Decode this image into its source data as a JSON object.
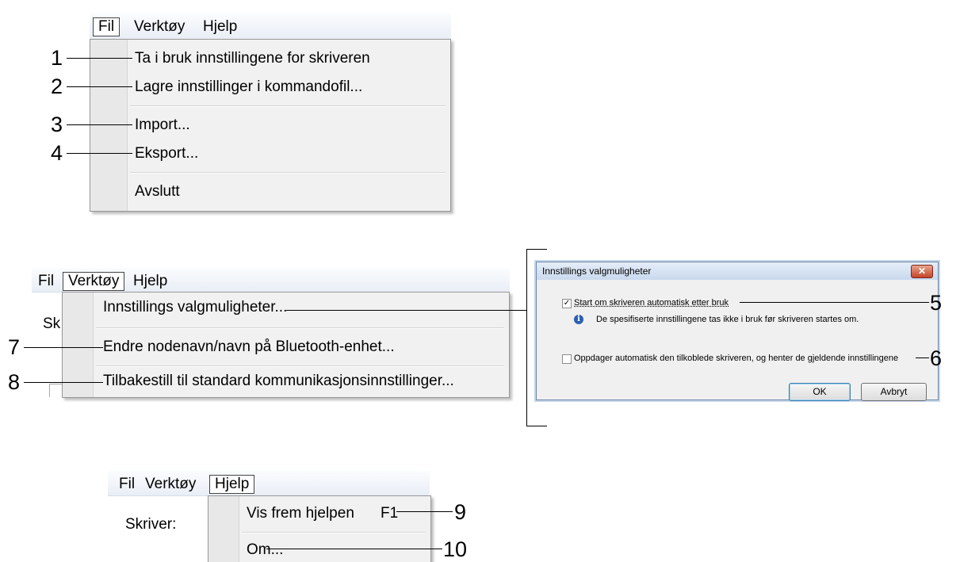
{
  "panel1": {
    "menubar": {
      "fil": "Fil",
      "verktoy": "Verktøy",
      "hjelp": "Hjelp"
    },
    "items": [
      "Ta i bruk innstillingene for skriveren",
      "Lagre innstillinger i kommandofil...",
      "Import...",
      "Eksport...",
      "Avslutt"
    ],
    "callouts": [
      "1",
      "2",
      "3",
      "4"
    ]
  },
  "panel2": {
    "menubar": {
      "fil": "Fil",
      "verktoy": "Verktøy",
      "hjelp": "Hjelp"
    },
    "background_text": "Sk",
    "items": [
      "Innstillings valgmuligheter...",
      "Endre nodenavn/navn på Bluetooth-enhet...",
      "Tilbakestill til standard kommunikasjonsinnstillinger..."
    ],
    "callouts": [
      "7",
      "8"
    ]
  },
  "dialog": {
    "title": "Innstillings valgmuligheter",
    "close_glyph": "✕",
    "checkbox1_label": "Start om skriveren automatisk etter bruk",
    "checkbox1_checked": true,
    "note": "De spesifiserte innstillingene tas ikke i bruk før skriveren startes om.",
    "checkbox2_label": "Oppdager automatisk den tilkoblede skriveren, og henter de gjeldende innstillingene",
    "checkbox2_checked": false,
    "ok_label": "OK",
    "cancel_label": "Avbryt",
    "callouts": [
      "5",
      "6"
    ]
  },
  "panel3": {
    "menubar": {
      "fil": "Fil",
      "verktoy": "Verktøy",
      "hjelp": "Hjelp"
    },
    "background_text": "Skriver:",
    "items": [
      "Vis frem hjelpen",
      "Om..."
    ],
    "shortcut": "F1",
    "callouts": [
      "9",
      "10"
    ]
  }
}
